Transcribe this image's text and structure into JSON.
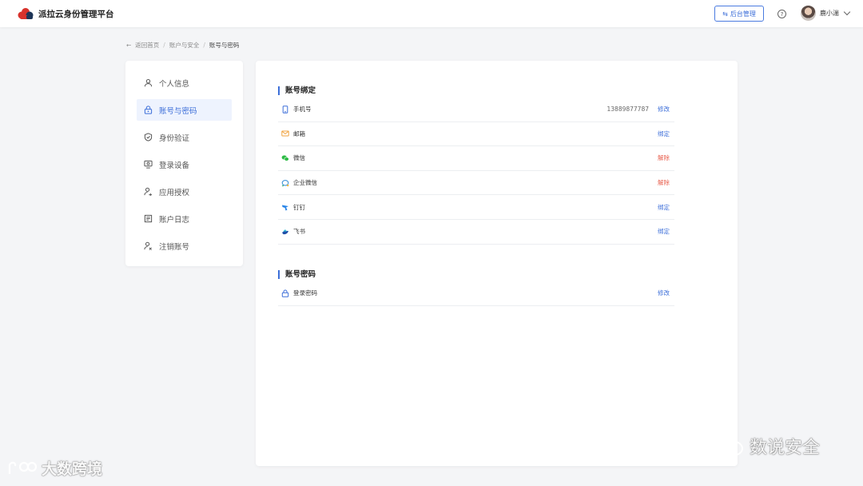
{
  "header": {
    "brand_name": "派拉云身份管理平台",
    "admin_button_label": "后台管理",
    "help_icon": "question-circle-icon",
    "user_name": "鹿小湍"
  },
  "breadcrumb": {
    "back_label": "返回首页",
    "parent": "账户与安全",
    "current": "账号与密码"
  },
  "sidebar": {
    "items": [
      {
        "label": "个人信息",
        "icon": "user-icon",
        "active": false
      },
      {
        "label": "账号与密码",
        "icon": "lock-icon",
        "active": true
      },
      {
        "label": "身份验证",
        "icon": "shield-check-icon",
        "active": false
      },
      {
        "label": "登录设备",
        "icon": "monitor-icon",
        "active": false
      },
      {
        "label": "应用授权",
        "icon": "user-key-icon",
        "active": false
      },
      {
        "label": "账户日志",
        "icon": "log-icon",
        "active": false
      },
      {
        "label": "注销账号",
        "icon": "user-remove-icon",
        "active": false
      }
    ]
  },
  "binding": {
    "title": "账号绑定",
    "rows": [
      {
        "label": "手机号",
        "icon": "phone-icon",
        "value": "13889877787",
        "action": "修改",
        "action_color": "#3d6fd9"
      },
      {
        "label": "邮箱",
        "icon": "mail-icon",
        "value": "",
        "action": "绑定",
        "action_color": "#3d6fd9"
      },
      {
        "label": "微信",
        "icon": "wechat-icon",
        "value": "",
        "action": "解除",
        "action_color": "#e8604f"
      },
      {
        "label": "企业微信",
        "icon": "wecom-icon",
        "value": "",
        "action": "解除",
        "action_color": "#e8604f"
      },
      {
        "label": "钉钉",
        "icon": "dingtalk-icon",
        "value": "",
        "action": "绑定",
        "action_color": "#3d6fd9"
      },
      {
        "label": "飞书",
        "icon": "feishu-icon",
        "value": "",
        "action": "绑定",
        "action_color": "#3d6fd9"
      }
    ]
  },
  "password": {
    "title": "账号密码",
    "rows": [
      {
        "label": "登录密码",
        "icon": "lock-icon",
        "action": "修改",
        "action_color": "#3d6fd9"
      }
    ]
  },
  "watermarks": {
    "left": "大数跨境",
    "right": "数说安全"
  },
  "colors": {
    "accent": "#3d6fd9",
    "danger": "#e8604f",
    "background": "#f4f5f7"
  }
}
